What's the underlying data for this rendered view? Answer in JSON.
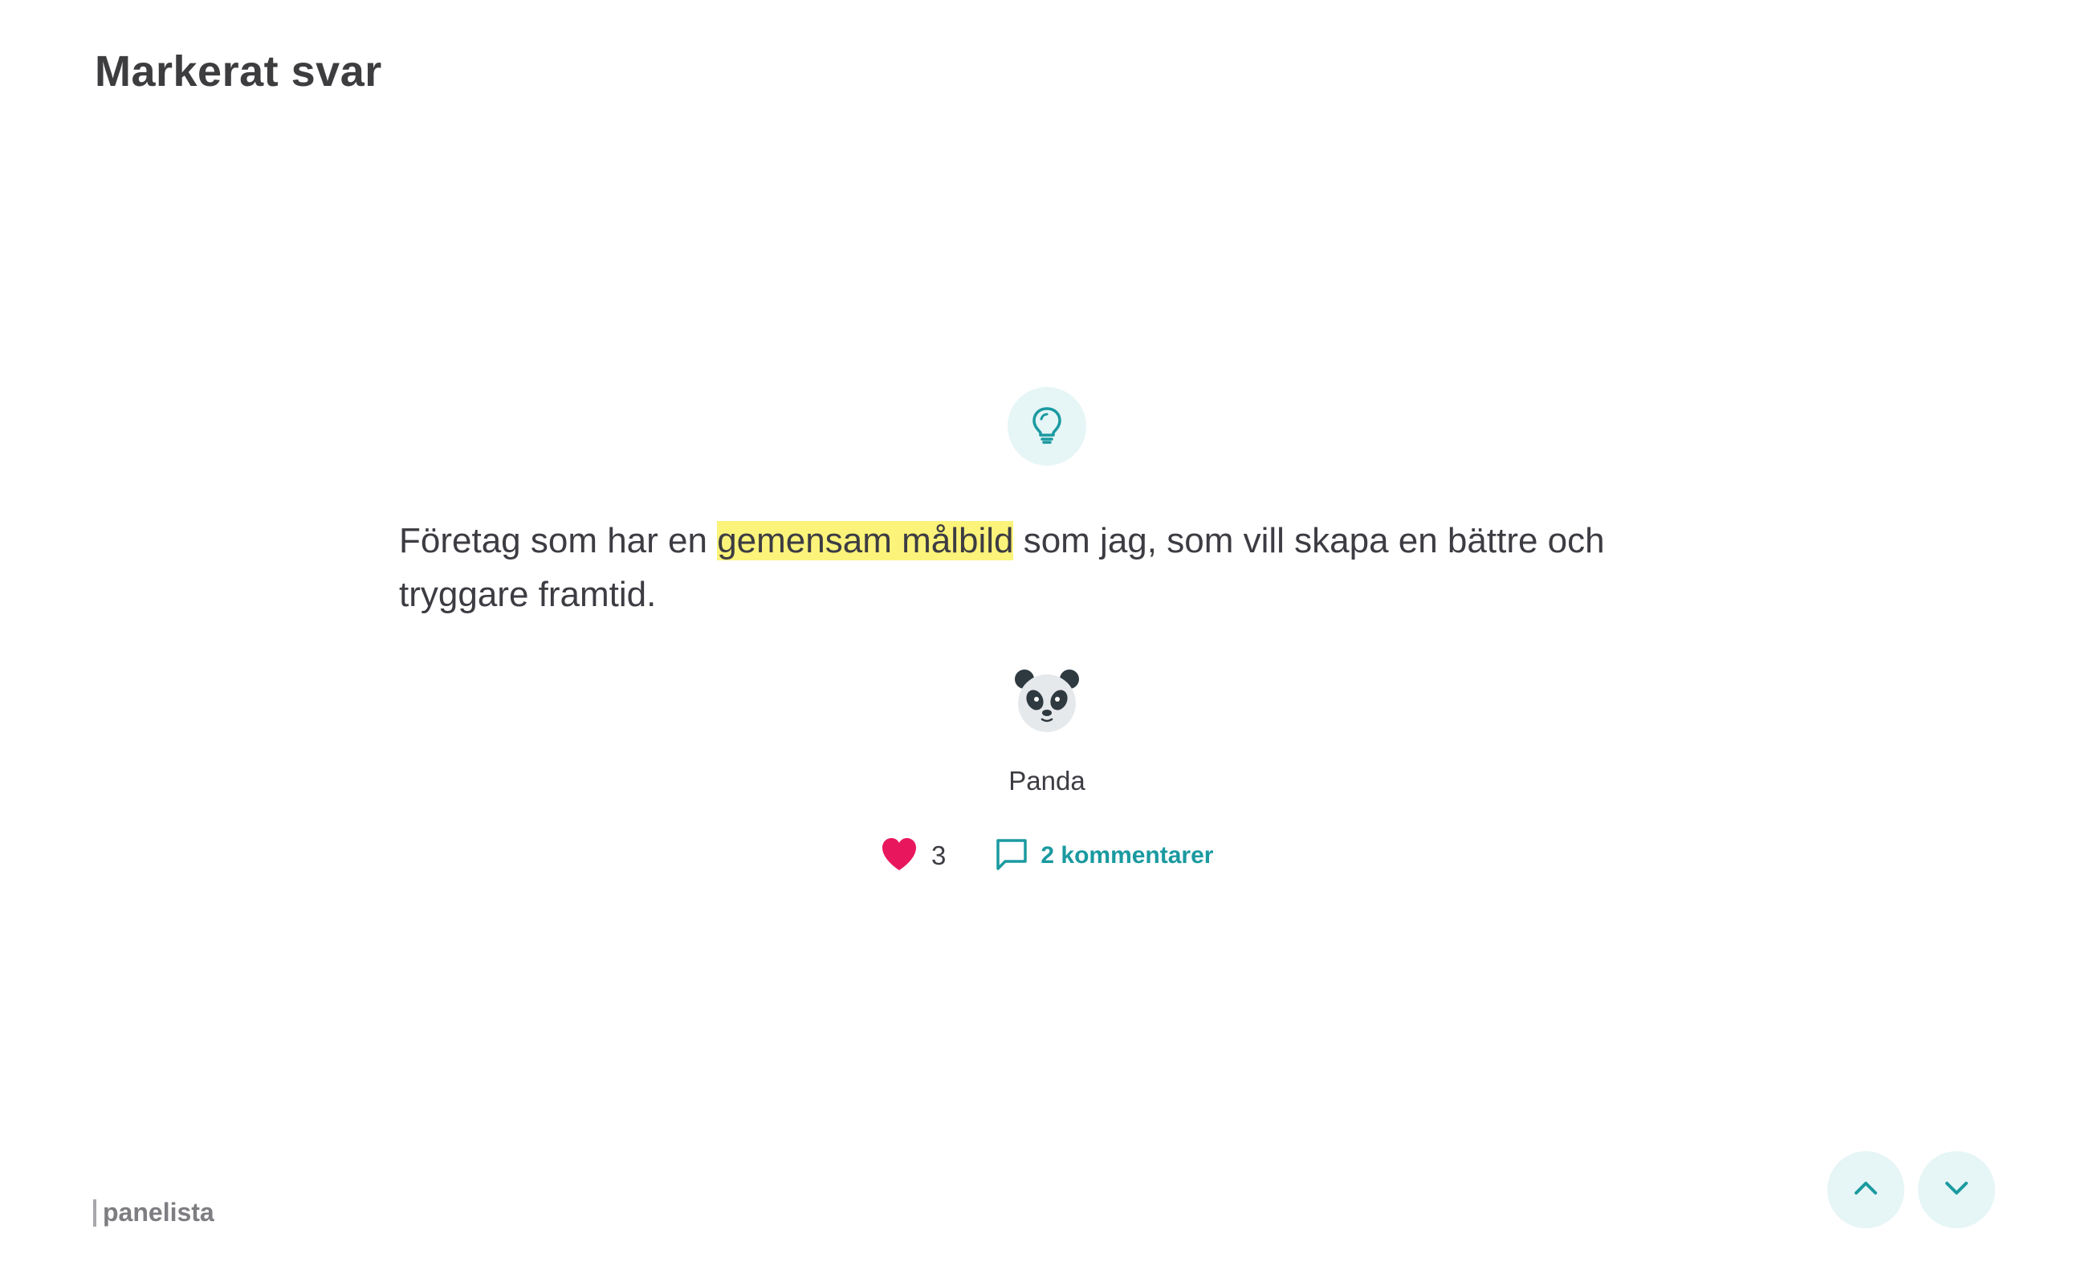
{
  "header": {
    "title": "Markerat svar"
  },
  "answer": {
    "badge_icon": "lightbulb-icon",
    "text_before": "Företag som har en ",
    "highlight": "gemensam målbild",
    "text_after": " som jag, som vill skapa en bättre och tryggare framtid.",
    "highlight_color": "#fcf37a"
  },
  "author": {
    "avatar_icon": "panda-icon",
    "name": "Panda"
  },
  "actions": {
    "like_icon": "heart-icon",
    "like_count": "3",
    "comment_icon": "comment-bubble-icon",
    "comments_label": "2 kommentarer"
  },
  "footer": {
    "brand": "panelista"
  },
  "navigation": {
    "up_icon": "chevron-up-icon",
    "down_icon": "chevron-down-icon"
  },
  "colors": {
    "accent": "#1a9aa0",
    "accent_bg": "#e6f5f6",
    "heart": "#e8175d",
    "text": "#3c3c43"
  }
}
